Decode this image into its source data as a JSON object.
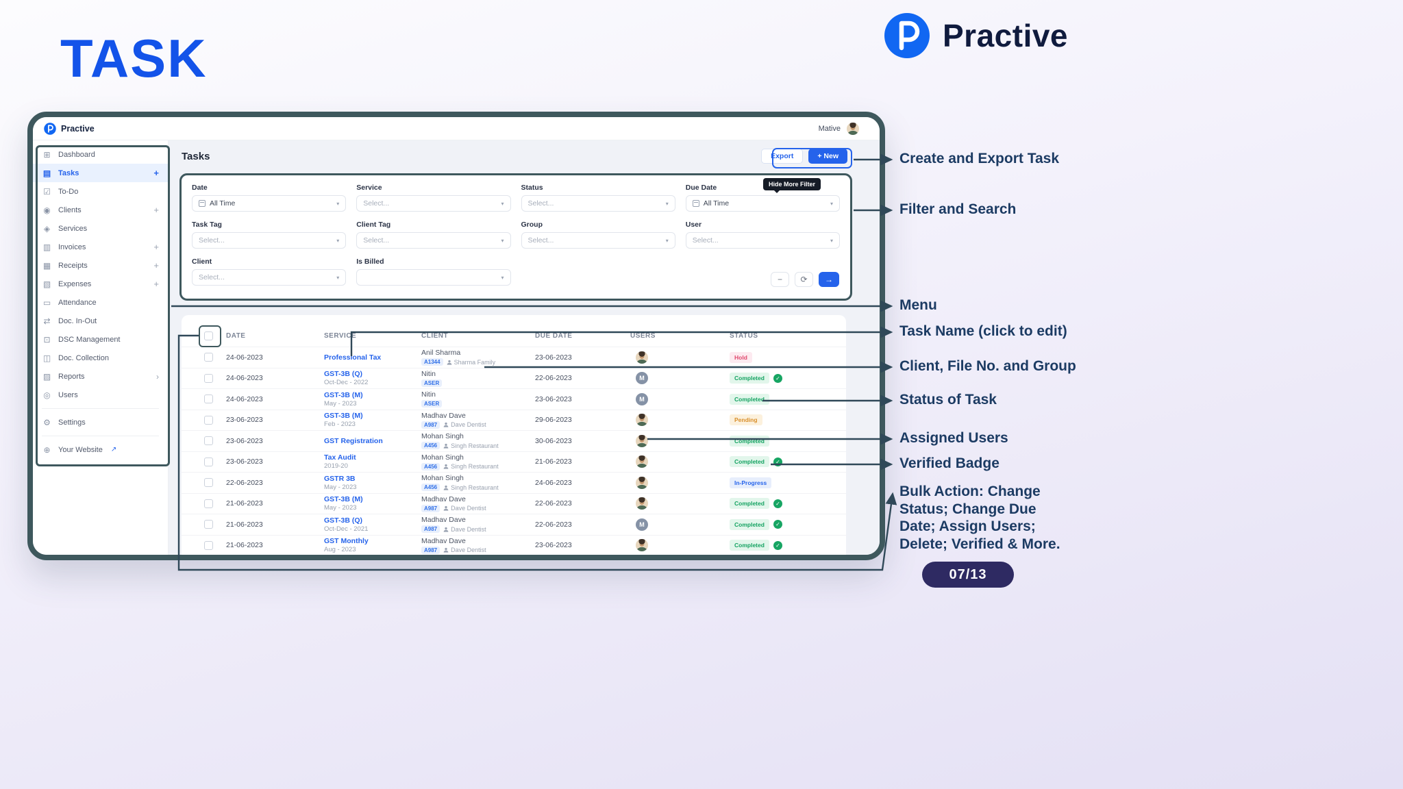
{
  "page": {
    "title": "TASK",
    "badge": "07/13"
  },
  "brand": {
    "name": "Practive"
  },
  "colors": {
    "accent": "#2563eb",
    "title_blue": "#1353e9",
    "frame": "#3e585d",
    "annotation_text": "#1c3b63",
    "badge_bg": "#2e2a62",
    "status_hold": "#e0486d",
    "status_completed": "#15a362",
    "status_pending": "#d98f2b",
    "status_in_progress": "#2563eb"
  },
  "annotations": [
    {
      "label": "Create and Export Task"
    },
    {
      "label": "Filter and Search"
    },
    {
      "label": "Menu"
    },
    {
      "label": "Task Name (click to edit)"
    },
    {
      "label": "Client, File No. and Group"
    },
    {
      "label": "Status of Task"
    },
    {
      "label": "Assigned Users"
    },
    {
      "label": "Verified Badge"
    },
    {
      "label": "Bulk Action: Change Status; Change Due Date; Assign Users; Delete; Verified & More."
    }
  ],
  "app": {
    "topbar": {
      "brand": "Practive",
      "user": "Mative"
    },
    "sidebar": {
      "items": [
        {
          "label": "Dashboard",
          "icon": "dashboard",
          "glyph": "⊞"
        },
        {
          "label": "Tasks",
          "icon": "tasks",
          "glyph": "▤",
          "plus": true,
          "active": true
        },
        {
          "label": "To-Do",
          "icon": "todo",
          "glyph": "☑"
        },
        {
          "label": "Clients",
          "icon": "clients",
          "glyph": "◉",
          "plus": true
        },
        {
          "label": "Services",
          "icon": "services",
          "glyph": "◈"
        },
        {
          "label": "Invoices",
          "icon": "invoices",
          "glyph": "▥",
          "plus": true
        },
        {
          "label": "Receipts",
          "icon": "receipts",
          "glyph": "▦",
          "plus": true
        },
        {
          "label": "Expenses",
          "icon": "expenses",
          "glyph": "▧",
          "plus": true
        },
        {
          "label": "Attendance",
          "icon": "attendance",
          "glyph": "▭"
        },
        {
          "label": "Doc. In-Out",
          "icon": "doc-in-out",
          "glyph": "⇄"
        },
        {
          "label": "DSC Management",
          "icon": "dsc-management",
          "glyph": "⊡"
        },
        {
          "label": "Doc. Collection",
          "icon": "doc-collection",
          "glyph": "◫"
        },
        {
          "label": "Reports",
          "icon": "reports",
          "glyph": "▨",
          "chevron": true
        },
        {
          "label": "Users",
          "icon": "users",
          "glyph": "◎"
        },
        {
          "label": "Settings",
          "icon": "settings",
          "glyph": "⚙",
          "divider_before": true
        },
        {
          "label": "Your Website",
          "icon": "website",
          "glyph": "⊕",
          "divider_before": true,
          "external": true
        }
      ]
    },
    "header": {
      "title": "Tasks",
      "export_label": "Export",
      "new_label": "+ New"
    },
    "filters": {
      "tooltip": "Hide More Filter",
      "collapse_label": "−",
      "refresh_label": "⟳",
      "apply_label": "→",
      "fields": [
        {
          "label": "Date",
          "value": "All Time",
          "type": "date"
        },
        {
          "label": "Service",
          "value": "Select...",
          "type": "select"
        },
        {
          "label": "Status",
          "value": "Select...",
          "type": "select"
        },
        {
          "label": "Due Date",
          "value": "All Time",
          "type": "date"
        },
        {
          "label": "Task Tag",
          "value": "Select...",
          "type": "select"
        },
        {
          "label": "Client Tag",
          "value": "Select...",
          "type": "select"
        },
        {
          "label": "Group",
          "value": "Select...",
          "type": "select"
        },
        {
          "label": "User",
          "value": "Select...",
          "type": "select"
        },
        {
          "label": "Client",
          "value": "Select...",
          "type": "select"
        },
        {
          "label": "Is Billed",
          "value": "",
          "type": "select"
        }
      ]
    },
    "table": {
      "columns": [
        "DATE",
        "SERVICE",
        "CLIENT",
        "DUE DATE",
        "USERS",
        "STATUS"
      ],
      "rows": [
        {
          "date": "24-06-2023",
          "service": "Professional Tax",
          "sub": "",
          "client": "Anil Sharma",
          "file": "A1344",
          "group": "Sharma Family",
          "due": "23-06-2023",
          "avatar": "photo",
          "status": "Hold",
          "verified": false
        },
        {
          "date": "24-06-2023",
          "service": "GST-3B (Q)",
          "sub": "Oct-Dec - 2022",
          "client": "Nitin",
          "file": "ASER",
          "group": "",
          "due": "22-06-2023",
          "avatar": "M",
          "status": "Completed",
          "verified": true
        },
        {
          "date": "24-06-2023",
          "service": "GST-3B (M)",
          "sub": "May - 2023",
          "client": "Nitin",
          "file": "ASER",
          "group": "",
          "due": "23-06-2023",
          "avatar": "M",
          "status": "Completed",
          "verified": false
        },
        {
          "date": "23-06-2023",
          "service": "GST-3B (M)",
          "sub": "Feb - 2023",
          "client": "Madhav Dave",
          "file": "A987",
          "group": "Dave Dentist",
          "due": "29-06-2023",
          "avatar": "photo",
          "status": "Pending",
          "verified": false
        },
        {
          "date": "23-06-2023",
          "service": "GST Registration",
          "sub": "",
          "client": "Mohan Singh",
          "file": "A456",
          "group": "Singh Restaurant",
          "due": "30-06-2023",
          "avatar": "photo",
          "status": "Completed",
          "verified": false
        },
        {
          "date": "23-06-2023",
          "service": "Tax Audit",
          "sub": "2019-20",
          "client": "Mohan Singh",
          "file": "A456",
          "group": "Singh Restaurant",
          "due": "21-06-2023",
          "avatar": "photo",
          "status": "Completed",
          "verified": true
        },
        {
          "date": "22-06-2023",
          "service": "GSTR 3B",
          "sub": "May - 2023",
          "client": "Mohan Singh",
          "file": "A456",
          "group": "Singh Restaurant",
          "due": "24-06-2023",
          "avatar": "photo",
          "status": "In-Progress",
          "verified": false
        },
        {
          "date": "21-06-2023",
          "service": "GST-3B (M)",
          "sub": "May - 2023",
          "client": "Madhav Dave",
          "file": "A987",
          "group": "Dave Dentist",
          "due": "22-06-2023",
          "avatar": "photo",
          "status": "Completed",
          "verified": true
        },
        {
          "date": "21-06-2023",
          "service": "GST-3B (Q)",
          "sub": "Oct-Dec - 2021",
          "client": "Madhav Dave",
          "file": "A987",
          "group": "Dave Dentist",
          "due": "22-06-2023",
          "avatar": "M",
          "status": "Completed",
          "verified": true
        },
        {
          "date": "21-06-2023",
          "service": "GST Monthly",
          "sub": "Aug - 2023",
          "client": "Madhav Dave",
          "file": "A987",
          "group": "Dave Dentist",
          "due": "23-06-2023",
          "avatar": "photo",
          "status": "Completed",
          "verified": true
        }
      ]
    }
  }
}
